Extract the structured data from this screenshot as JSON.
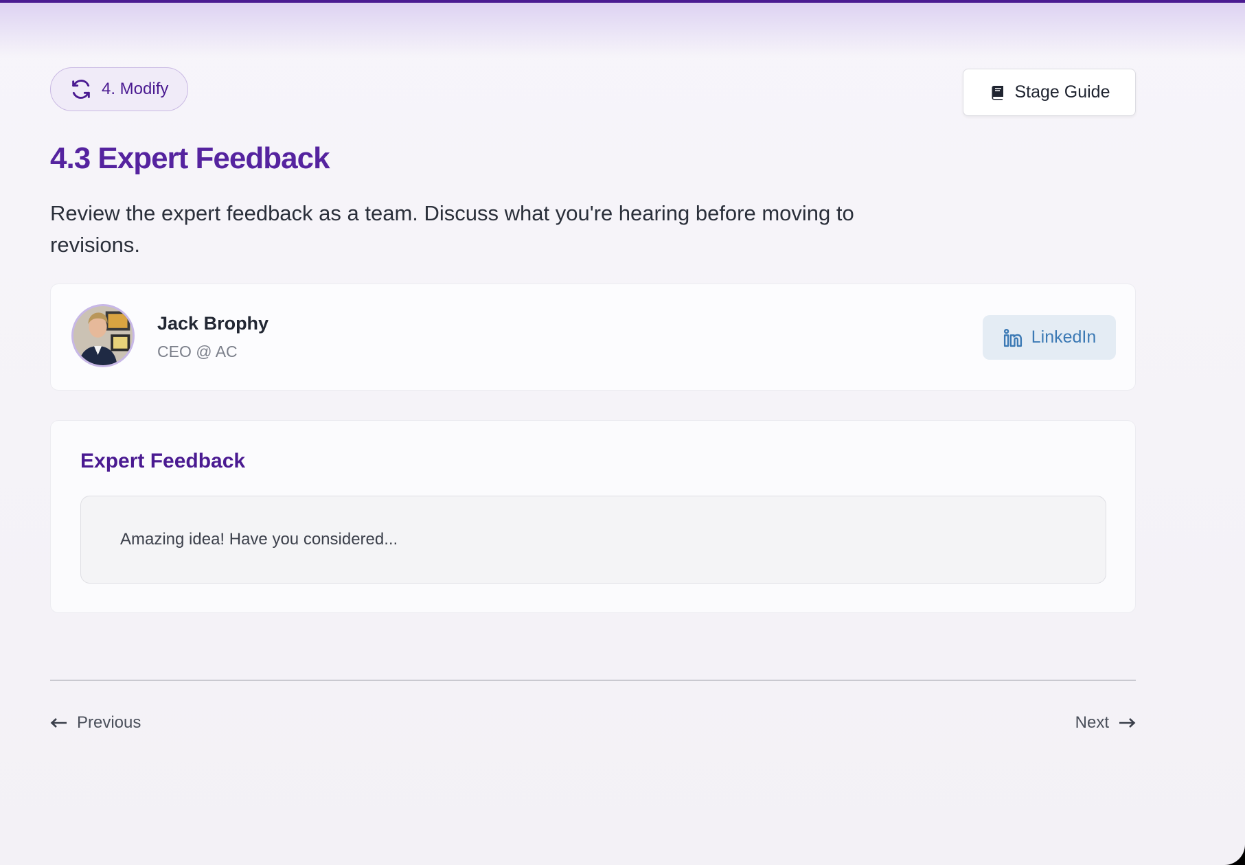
{
  "stage": {
    "label": "4. Modify",
    "icon": "refresh-icon"
  },
  "guide_button": {
    "label": "Stage Guide",
    "icon": "book-icon"
  },
  "page": {
    "title": "4.3 Expert Feedback",
    "subtitle": "Review the expert feedback as a team. Discuss what you're hearing before moving to revisions."
  },
  "expert": {
    "name": "Jack Brophy",
    "role": "CEO @ AC",
    "linkedin_label": "LinkedIn"
  },
  "feedback": {
    "heading": "Expert Feedback",
    "text": "Amazing idea! Have you considered..."
  },
  "navigation": {
    "previous_label": "Previous",
    "next_label": "Next"
  },
  "colors": {
    "brand_purple": "#4a1a91",
    "title_purple": "#55239f",
    "linkedin_blue": "#3b79b4",
    "linkedin_bg": "#e4ecf4"
  }
}
